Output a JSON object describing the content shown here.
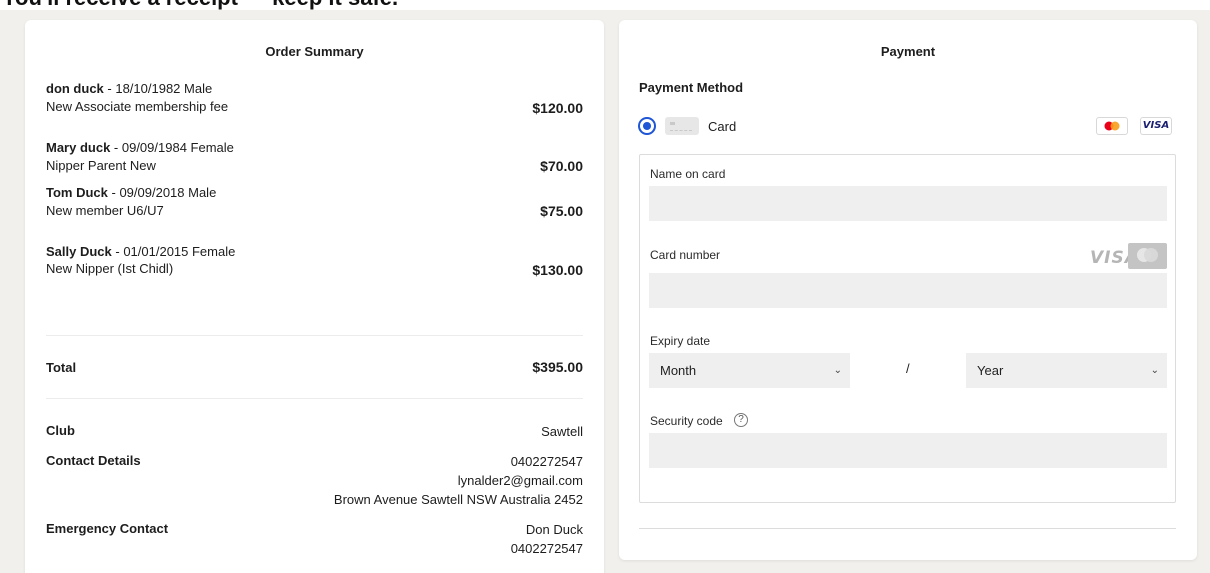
{
  "page": {
    "banner": "You'll receive a receipt — keep it safe."
  },
  "order_summary": {
    "title": "Order Summary",
    "items": [
      {
        "name": "don duck",
        "details": " - 18/10/1982 Male",
        "description": "New Associate membership fee",
        "price": "$120.00"
      },
      {
        "name": "Mary duck",
        "details": " - 09/09/1984 Female",
        "description": "Nipper Parent New",
        "price": "$70.00"
      },
      {
        "name": "Tom Duck",
        "details": " - 09/09/2018 Male",
        "description": "New member U6/U7",
        "price": "$75.00"
      },
      {
        "name": "Sally Duck",
        "details": " - 01/01/2015 Female",
        "description": "New Nipper (Ist Chidl)",
        "price": "$130.00"
      }
    ],
    "total_label": "Total",
    "total_value": "$395.00",
    "club_label": "Club",
    "club_value": "Sawtell",
    "contact_label": "Contact Details",
    "contact_phone": "0402272547",
    "contact_email": "lynalder2@gmail.com",
    "contact_address": "Brown Avenue Sawtell NSW Australia 2452",
    "emergency_label": "Emergency Contact",
    "emergency_name": "Don Duck",
    "emergency_phone": "0402272547"
  },
  "payment": {
    "title": "Payment",
    "method_title": "Payment Method",
    "card_option_label": "Card",
    "mastercard_icon": "mastercard-icon",
    "visa_brand": "VISA",
    "name_label": "Name on card",
    "number_label": "Card number",
    "number_visa_brand": "VISA",
    "expiry_label": "Expiry date",
    "month_value": "Month",
    "separator": "/",
    "year_value": "Year",
    "security_label": "Security code",
    "help_glyph": "?"
  },
  "colors": {
    "accent": "#1f56d6",
    "background": "#f1f0ec",
    "input_fill": "#efefef"
  }
}
